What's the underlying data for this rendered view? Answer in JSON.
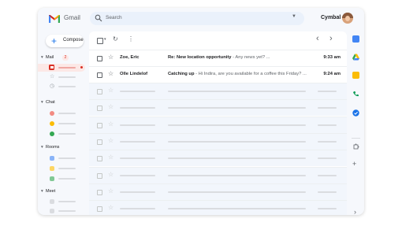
{
  "app": {
    "brand": "Gmail",
    "account": "Cymbal"
  },
  "search": {
    "placeholder": "Search"
  },
  "compose": {
    "label": "Compose"
  },
  "sidebar": {
    "mail_label": "Mail",
    "mail_badge": "2",
    "chat_label": "Chat",
    "rooms_label": "Rooms",
    "meet_label": "Meet"
  },
  "emails": [
    {
      "sender": "Zoe, Eric",
      "subject": "Re: New location opportunity",
      "snippet": " - Any news yet? ...",
      "time": "9:33 am"
    },
    {
      "sender": "Olle Lindelof",
      "subject": "Catching up",
      "snippet": " - Hi Indira, are you available for a coffee this Friday? ...",
      "time": "9:24 am"
    }
  ],
  "colors": {
    "accent": "#1a73e8",
    "gmail_red": "#d93025",
    "chat_dots": [
      "#f28b82",
      "#fbbc04",
      "#34a853"
    ],
    "room_dots": [
      "#8ab4f8",
      "#fdd663",
      "#81c995"
    ]
  },
  "icons": {
    "rail": [
      "calendar-icon",
      "drive-icon",
      "keep-icon",
      "voice-icon",
      "tasks-icon",
      "addons-icon",
      "add-icon",
      "expand-panel-icon"
    ]
  }
}
